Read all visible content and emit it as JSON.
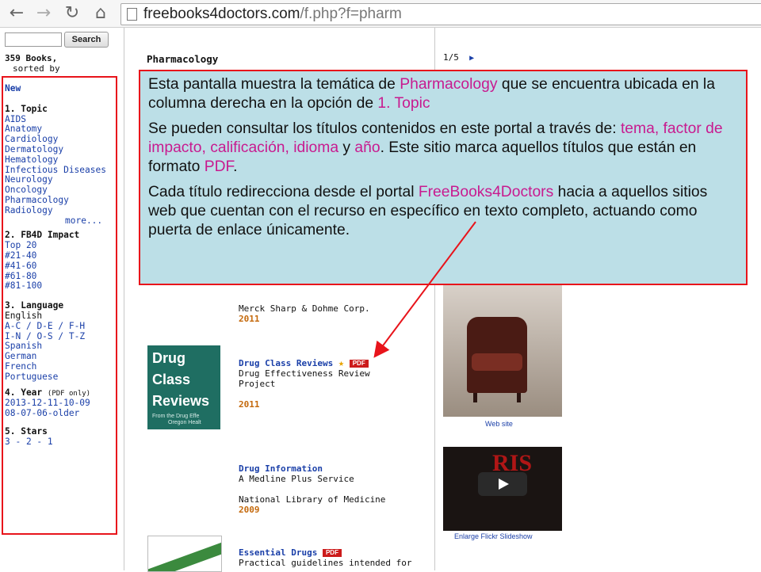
{
  "browser": {
    "url_domain": "freebooks4doctors.com",
    "url_path": "/f.php?f=pharm",
    "url_full": "freebooks4doctors.com/f.php?f=pharm"
  },
  "sidebar": {
    "search_button": "Search",
    "books_count": "359 Books,",
    "sorted_by": "sorted by",
    "new_label": "New",
    "topic_heading": "1. Topic",
    "topics": [
      "AIDS",
      "Anatomy",
      "Cardiology",
      "Dermatology",
      "Hematology",
      "Infectious Diseases",
      "Neurology",
      "Oncology",
      "Pharmacology",
      "Radiology"
    ],
    "more": "more...",
    "impact_heading": "2. FB4D Impact",
    "impact": [
      "Top 20",
      "#21-40",
      "#41-60",
      "#61-80",
      "#81-100"
    ],
    "language_heading": "3. Language",
    "language_english": "English",
    "language_ranges_1": [
      "A-C /",
      "D-E /",
      "F-H"
    ],
    "language_ranges_2": [
      "I-N /",
      "O-S /",
      "T-Z"
    ],
    "languages_other": [
      "Spanish",
      "German",
      "French",
      "Portuguese"
    ],
    "year_heading": "4. Year",
    "year_note": "(PDF only)",
    "years_1": "2013-12-11-10-09",
    "years_2": "08-07-06-older",
    "stars_heading": "5. Stars",
    "stars": "3 - 2 - 1"
  },
  "main": {
    "section_title": "Pharmacology",
    "book0": {
      "publisher": "Merck Sharp & Dohme Corp.",
      "year": "2011"
    },
    "book1": {
      "title": "Drug Class Reviews",
      "subtitle_1": "Drug Effectiveness Review",
      "subtitle_2": "Project",
      "year": "2011",
      "pdf": "PDF",
      "cover_lines": [
        "Drug",
        "Class",
        "Reviews"
      ],
      "cover_small_1": "From the Drug Effe",
      "cover_small_2": "Oregon Healt"
    },
    "book2": {
      "title": "Drug Information",
      "subtitle": "A Medline Plus Service",
      "publisher": "National Library of Medicine",
      "year": "2009"
    },
    "book3": {
      "title": "Essential Drugs",
      "pdf": "PDF",
      "subtitle": "Practical guidelines intended for"
    }
  },
  "right": {
    "pager": "1/5",
    "web_site": "Web site",
    "enlarge": "Enlarge Flickr Slideshow",
    "video_text": "RIS"
  },
  "callout": {
    "p1_a": "Esta pantalla muestra la temática de ",
    "p1_b": "Pharmacology",
    "p1_c": " que se encuentra ubicada en la columna derecha en la opción de ",
    "p1_d": "1. Topic",
    "p2_a": "Se pueden consultar los títulos contenidos en este portal a través de: ",
    "p2_b": "tema, factor de impacto, calificación, idioma",
    "p2_c": " y ",
    "p2_d": "año",
    "p2_e": ".  Este sitio marca aquellos títulos que están en formato ",
    "p2_f": "PDF",
    "p2_g": ".",
    "p3_a": "Cada título redirecciona desde el portal ",
    "p3_b": "FreeBooks4Doctors",
    "p3_c": " hacia a aquellos sitios web que cuentan con el recurso en específico en texto completo, actuando como puerta de enlace únicamente."
  },
  "colors": {
    "annotation_red": "#e8141b",
    "callout_bg": "#bcdfe7",
    "highlight_pink": "#c81a8f",
    "link_blue": "#1a3fa8",
    "year_orange": "#c4690c"
  }
}
